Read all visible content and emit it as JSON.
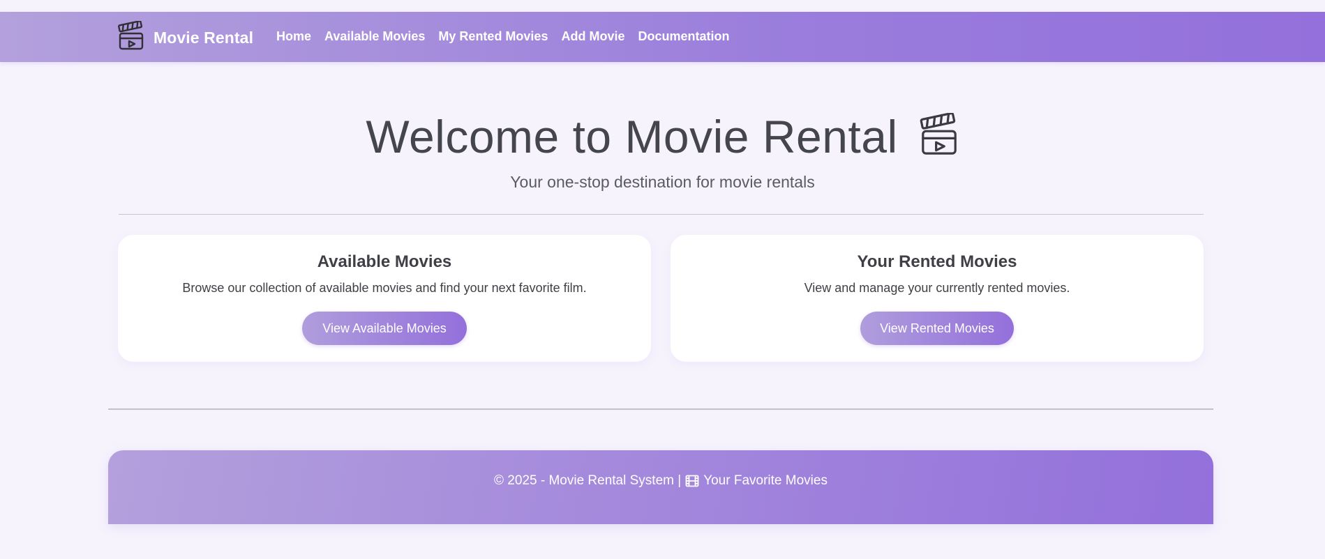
{
  "navbar": {
    "brand_icon": "clapperboard-icon",
    "brand_name": "Movie Rental",
    "links": [
      {
        "label": "Home"
      },
      {
        "label": "Available Movies"
      },
      {
        "label": "My Rented Movies"
      },
      {
        "label": "Add Movie"
      },
      {
        "label": "Documentation"
      }
    ]
  },
  "hero": {
    "title": "Welcome to Movie Rental",
    "title_icon": "clapperboard-icon",
    "subtitle": "Your one-stop destination for movie rentals"
  },
  "cards": [
    {
      "title": "Available Movies",
      "text": "Browse our collection of available movies and find your next favorite film.",
      "button": "View Available Movies"
    },
    {
      "title": "Your Rented Movies",
      "text": "View and manage your currently rented movies.",
      "button": "View Rented Movies"
    }
  ],
  "footer": {
    "text_before": "© 2025 - Movie Rental System |",
    "icon": "film-icon",
    "text_after": "Your Favorite Movies"
  },
  "colors": {
    "accent": "#9370db",
    "accent_light": "#b3a0dc",
    "background": "#f6f3fd"
  }
}
